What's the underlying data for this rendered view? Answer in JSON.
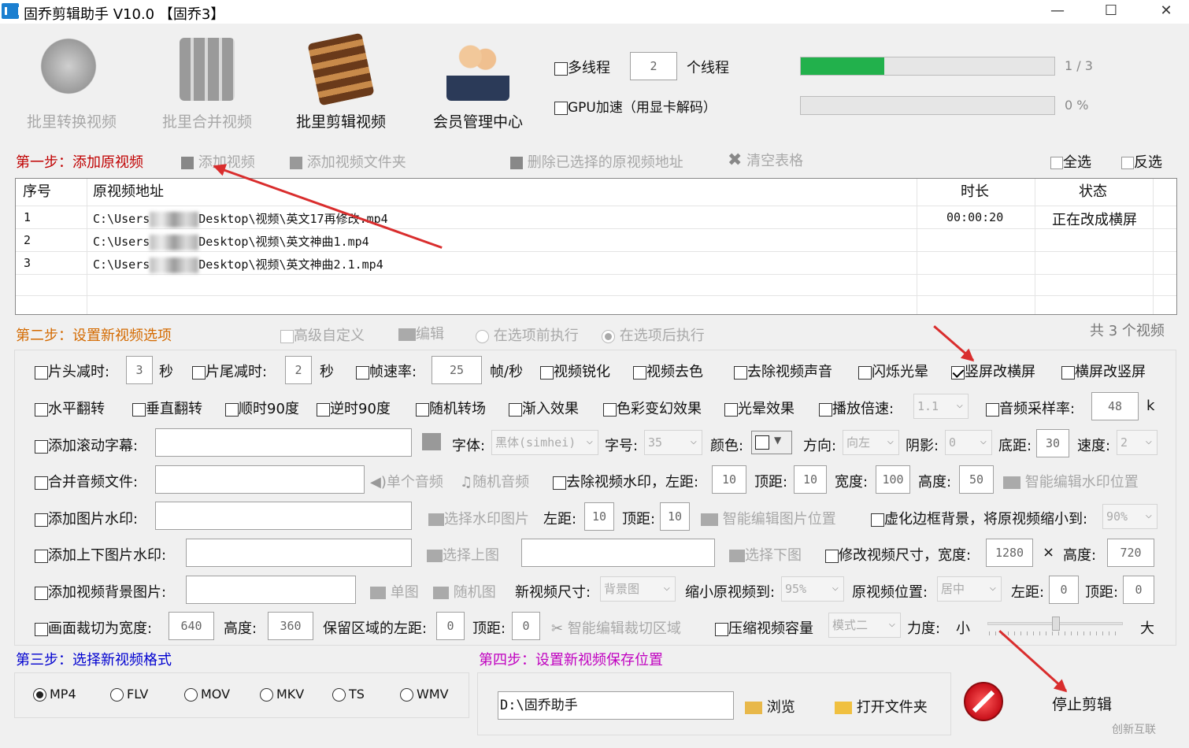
{
  "titlebar": {
    "title": "固乔剪辑助手 V10.0 【固乔3】",
    "minimize": "—",
    "maximize": "☐",
    "close": "✕"
  },
  "toolbar": {
    "convert": "批里转换视频",
    "merge": "批里合并视频",
    "edit": "批里剪辑视频",
    "member": "会员管理中心"
  },
  "threads": {
    "multi_label": "多线程",
    "count": "2",
    "unit": "个线程",
    "gpu_label": "GPU加速（用显卡解码）",
    "progress_text": "1 / 3",
    "progress_fraction": 0.33,
    "percent_text": "0 %",
    "percent_fraction": 0
  },
  "step1": {
    "title": "第一步：添加原视频",
    "add_video": "添加视频",
    "add_folder": "添加视频文件夹",
    "delete_selected": "删除已选择的原视频地址",
    "clear_table": "清空表格",
    "select_all": "全选",
    "invert": "反选"
  },
  "table": {
    "headers": [
      "序号",
      "原视频地址",
      "时长",
      "状态"
    ],
    "rows": [
      {
        "no": "1",
        "path_pre": "C:\\Users",
        "path_post": "Desktop\\视频\\英文17再修改.mp4",
        "duration": "00:00:20",
        "status": "正在改成横屏"
      },
      {
        "no": "2",
        "path_pre": "C:\\Users",
        "path_post": "Desktop\\视频\\英文神曲1.mp4",
        "duration": "",
        "status": ""
      },
      {
        "no": "3",
        "path_pre": "C:\\Users",
        "path_post": "Desktop\\视频\\英文神曲2.1.mp4",
        "duration": "",
        "status": ""
      }
    ]
  },
  "step2": {
    "title": "第二步：设置新视频选项",
    "advanced": "高级自定义",
    "edit": "编辑",
    "before": "在选项前执行",
    "after": "在选项后执行",
    "count": "共 3 个视频"
  },
  "opts": {
    "head_cut": "片头减时:",
    "head_val": "3",
    "sec1": "秒",
    "tail_cut": "片尾减时:",
    "tail_val": "2",
    "sec2": "秒",
    "fps": "帧速率:",
    "fps_val": "25",
    "fps_unit": "帧/秒",
    "sharpen": "视频锐化",
    "decolor": "视频去色",
    "remove_audio": "去除视频声音",
    "flash": "闪烁光晕",
    "v2h": "竖屏改横屏",
    "h2v": "横屏改竖屏",
    "hflip": "水平翻转",
    "vflip": "垂直翻转",
    "cw90": "顺时90度",
    "ccw90": "逆时90度",
    "transition": "随机转场",
    "fadein": "渐入效果",
    "colorfx": "色彩变幻效果",
    "lightfx": "光晕效果",
    "speed": "播放倍速:",
    "speed_val": "1.1",
    "samplerate": "音频采样率:",
    "samplerate_val": "48",
    "k": "k",
    "scroll": "添加滚动字幕:",
    "font": "字体:",
    "font_val": "黑体(simhei)",
    "size": "字号:",
    "size_val": "35",
    "color": "颜色:",
    "dir": "方向:",
    "dir_val": "向左",
    "shadow": "阴影:",
    "shadow_val": "0",
    "bottom": "底距:",
    "bottom_val": "30",
    "spd": "速度:",
    "spd_val": "2",
    "merge_audio": "合并音频文件:",
    "single_audio": "单个音频",
    "random_audio": "随机音频",
    "remove_wm": "去除视频水印，左距:",
    "wm_left": "10",
    "wm_top_l": "顶距:",
    "wm_top": "10",
    "wm_w_l": "宽度:",
    "wm_w": "100",
    "wm_h_l": "高度:",
    "wm_h": "50",
    "smart_wm": "智能编辑水印位置",
    "img_wm": "添加图片水印:",
    "choose_wm": "选择水印图片",
    "img_left_l": "左距:",
    "img_left": "10",
    "img_top_l": "顶距:",
    "img_top": "10",
    "smart_img": "智能编辑图片位置",
    "blur_bg": "虚化边框背景，将原视频缩小到:",
    "blur_val": "90%",
    "tb_wm": "添加上下图片水印:",
    "choose_top": "选择上图",
    "choose_bottom": "选择下图",
    "resize": "修改视频尺寸，宽度:",
    "res_w": "1280",
    "x": "×",
    "res_h_l": "高度:",
    "res_h": "720",
    "bg_img": "添加视频背景图片:",
    "single_img": "单图",
    "random_img": "随机图",
    "new_size": "新视频尺寸:",
    "new_size_val": "背景图",
    "shrink": "缩小原视频到:",
    "shrink_val": "95%",
    "pos": "原视频位置:",
    "pos_val": "居中",
    "pos_left_l": "左距:",
    "pos_left": "0",
    "pos_top_l": "顶距:",
    "pos_top": "0",
    "crop": "画面裁切为宽度:",
    "crop_w": "640",
    "crop_h_l": "高度:",
    "crop_h": "360",
    "keep": "保留区域的左距:",
    "keep_left": "0",
    "keep_top_l": "顶距:",
    "keep_top": "0",
    "smart_crop": "智能编辑裁切区域",
    "compress": "压缩视频容量",
    "mode": "模式二",
    "force": "力度:",
    "small": "小",
    "large": "大",
    "force_fraction": 0.5
  },
  "step3": {
    "title": "第三步：选择新视频格式",
    "formats": [
      "MP4",
      "FLV",
      "MOV",
      "MKV",
      "TS",
      "WMV"
    ],
    "selected": "MP4"
  },
  "step4": {
    "title": "第四步：设置新视频保存位置",
    "path": "D:\\固乔助手",
    "browse": "浏览",
    "open_folder": "打开文件夹",
    "stop": "停止剪辑"
  },
  "watermark": "创新互联",
  "colors": {
    "step1": "#c00000",
    "step2": "#d46a00",
    "step3": "#0000d0",
    "step4": "#c000c0",
    "progress": "#22b14c"
  }
}
